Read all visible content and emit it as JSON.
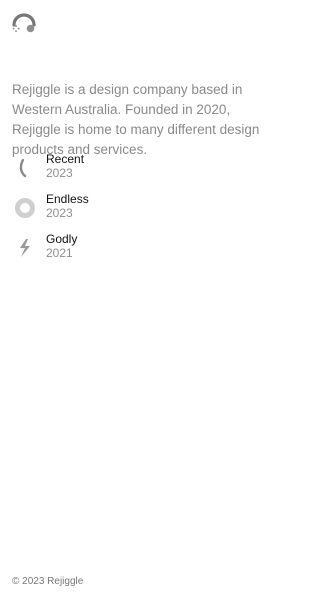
{
  "brand": {
    "icon_name": "dots-arc-logo-icon",
    "accent": "#8f8f8f"
  },
  "intro": {
    "text": "Rejiggle is a design company based in Western Australia. Founded in 2020, Rejiggle is home to many different design products and services."
  },
  "projects": [
    {
      "name": "Recent",
      "year": "2023",
      "icon_name": "curved-line-icon"
    },
    {
      "name": "Endless",
      "year": "2023",
      "icon_name": "ring-icon"
    },
    {
      "name": "Godly",
      "year": "2021",
      "icon_name": "lightning-icon"
    }
  ],
  "footer": {
    "text": "© 2023 Rejiggle"
  }
}
